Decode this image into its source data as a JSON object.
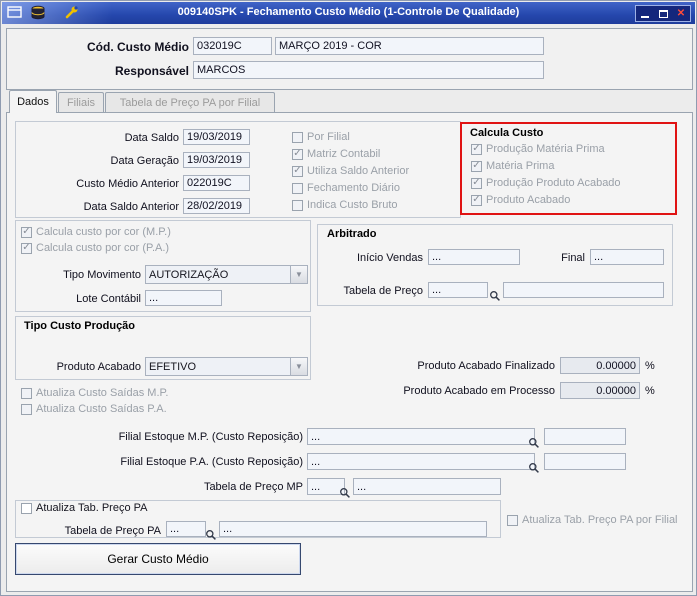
{
  "icons": {
    "dropdown": "▼",
    "close": "✕"
  },
  "titlebar": {
    "title": "009140SPK - Fechamento Custo Médio (1-Controle De Qualidade)"
  },
  "header": {
    "cod_label": "Cód. Custo Médio",
    "cod_value": "032019C",
    "cod_desc": "MARÇO 2019 - COR",
    "resp_label": "Responsável",
    "resp_value": "MARCOS"
  },
  "tabs": {
    "dados": "Dados",
    "filiais": "Filiais",
    "tabela_pa": "Tabela de Preço PA por Filial"
  },
  "saldo": {
    "data_saldo_label": "Data Saldo",
    "data_saldo": "19/03/2019",
    "data_geracao_label": "Data Geração",
    "data_geracao": "19/03/2019",
    "custo_anterior_label": "Custo Médio Anterior",
    "custo_anterior": "022019C",
    "data_saldo_anterior_label": "Data Saldo Anterior",
    "data_saldo_anterior": "28/02/2019"
  },
  "flags": {
    "por_filial": "Por Filial",
    "matriz_contabil": "Matriz Contabil",
    "utiliza_saldo": "Utiliza Saldo Anterior",
    "fechamento_diario": "Fechamento Diário",
    "indica_custo_bruto": "Indica Custo Bruto"
  },
  "calcula_custo": {
    "title": "Calcula Custo",
    "producao_mp": "Produção Matéria Prima",
    "mp": "Matéria Prima",
    "producao_pa": "Produção Produto Acabado",
    "pa": "Produto Acabado"
  },
  "cor": {
    "mp": "Calcula custo por cor (M.P.)",
    "pa": "Calcula custo por cor (P.A.)",
    "tipo_movimento_label": "Tipo Movimento",
    "tipo_movimento": "AUTORIZAÇÃO",
    "lote_label": "Lote Contábil",
    "lote": "..."
  },
  "arbitrado": {
    "title": "Arbitrado",
    "inicio_label": "Início Vendas",
    "inicio": "...",
    "final_label": "Final",
    "final": "...",
    "tabela_label": "Tabela de Preço",
    "tabela_code": "..."
  },
  "tipo_custo": {
    "title": "Tipo Custo Produção",
    "produto_label": "Produto Acabado",
    "produto": "EFETIVO",
    "atualiza_mp": "Atualiza Custo Saídas M.P.",
    "atualiza_pa": "Atualiza Custo Saídas P.A."
  },
  "percentual": {
    "finalizado_label": "Produto Acabado Finalizado",
    "finalizado": "0.00000",
    "processo_label": "Produto Acabado em Processo",
    "processo": "0.00000",
    "unit": "%"
  },
  "filiais": {
    "mp_label": "Filial Estoque M.P. (Custo Reposição)",
    "mp_value": "...",
    "pa_label": "Filial Estoque P.A. (Custo Reposição)",
    "pa_value": "...",
    "tabela_mp_label": "Tabela de Preço MP",
    "tabela_mp_code": "...",
    "tabela_mp_desc": "..."
  },
  "preco_pa": {
    "atualiza": "Atualiza Tab. Preço PA",
    "tabela_label": "Tabela de Preço PA",
    "tabela_code": "...",
    "tabela_desc": "...",
    "atualiza_filial": "Atualiza Tab. Preço PA por Filial"
  },
  "actions": {
    "gerar": "Gerar Custo Médio"
  }
}
